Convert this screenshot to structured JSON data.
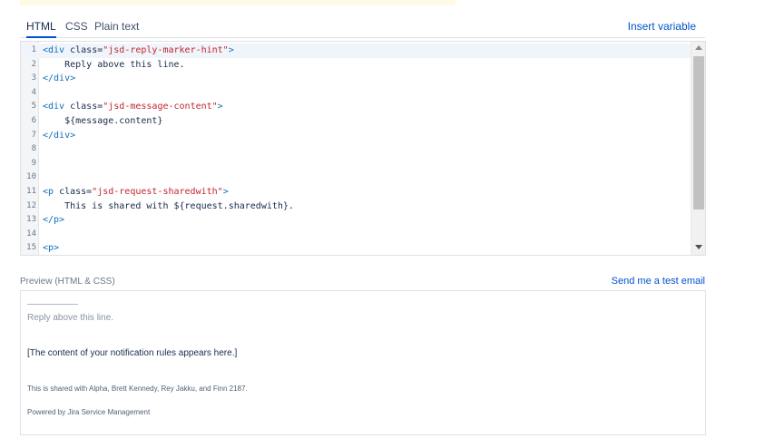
{
  "tabs": [
    {
      "label": "HTML",
      "active": true
    },
    {
      "label": "CSS",
      "active": false
    },
    {
      "label": "Plain text",
      "active": false
    }
  ],
  "insert_variable_label": "Insert variable",
  "editor": {
    "lines": [
      {
        "n": "1",
        "segments": [
          {
            "t": "<div ",
            "c": "tag"
          },
          {
            "t": "class=",
            "c": "attr"
          },
          {
            "t": "\"jsd-reply-marker-hint\"",
            "c": "str"
          },
          {
            "t": ">",
            "c": "tag"
          }
        ]
      },
      {
        "n": "2",
        "segments": [
          {
            "t": "    Reply above this line.",
            "c": ""
          }
        ]
      },
      {
        "n": "3",
        "segments": [
          {
            "t": "</div>",
            "c": "tag"
          }
        ]
      },
      {
        "n": "4",
        "segments": []
      },
      {
        "n": "5",
        "segments": [
          {
            "t": "<div ",
            "c": "tag"
          },
          {
            "t": "class=",
            "c": "attr"
          },
          {
            "t": "\"jsd-message-content\"",
            "c": "str"
          },
          {
            "t": ">",
            "c": "tag"
          }
        ]
      },
      {
        "n": "6",
        "segments": [
          {
            "t": "    ${message.content}",
            "c": ""
          }
        ]
      },
      {
        "n": "7",
        "segments": [
          {
            "t": "</div>",
            "c": "tag"
          }
        ]
      },
      {
        "n": "8",
        "segments": []
      },
      {
        "n": "9",
        "segments": []
      },
      {
        "n": "10",
        "segments": []
      },
      {
        "n": "11",
        "segments": [
          {
            "t": "<p ",
            "c": "tag"
          },
          {
            "t": "class=",
            "c": "attr"
          },
          {
            "t": "\"jsd-request-sharedwith\"",
            "c": "str"
          },
          {
            "t": ">",
            "c": "tag"
          }
        ]
      },
      {
        "n": "12",
        "segments": [
          {
            "t": "    This is shared with ${request.sharedwith}.",
            "c": ""
          }
        ]
      },
      {
        "n": "13",
        "segments": [
          {
            "t": "</p>",
            "c": "tag"
          }
        ]
      },
      {
        "n": "14",
        "segments": []
      },
      {
        "n": "15",
        "segments": [
          {
            "t": "<p>",
            "c": "tag"
          }
        ]
      }
    ]
  },
  "preview_label": "Preview (HTML & CSS)",
  "send_test_label": "Send me a test email",
  "preview": {
    "reply_hint": "Reply above this line.",
    "content_placeholder": "[The content of your notification rules appears here.]",
    "shared_with": "This is shared with Alpha, Brett Kennedy, Rey Jakku, and Finn 2187.",
    "powered_by": "Powered by Jira Service Management"
  }
}
